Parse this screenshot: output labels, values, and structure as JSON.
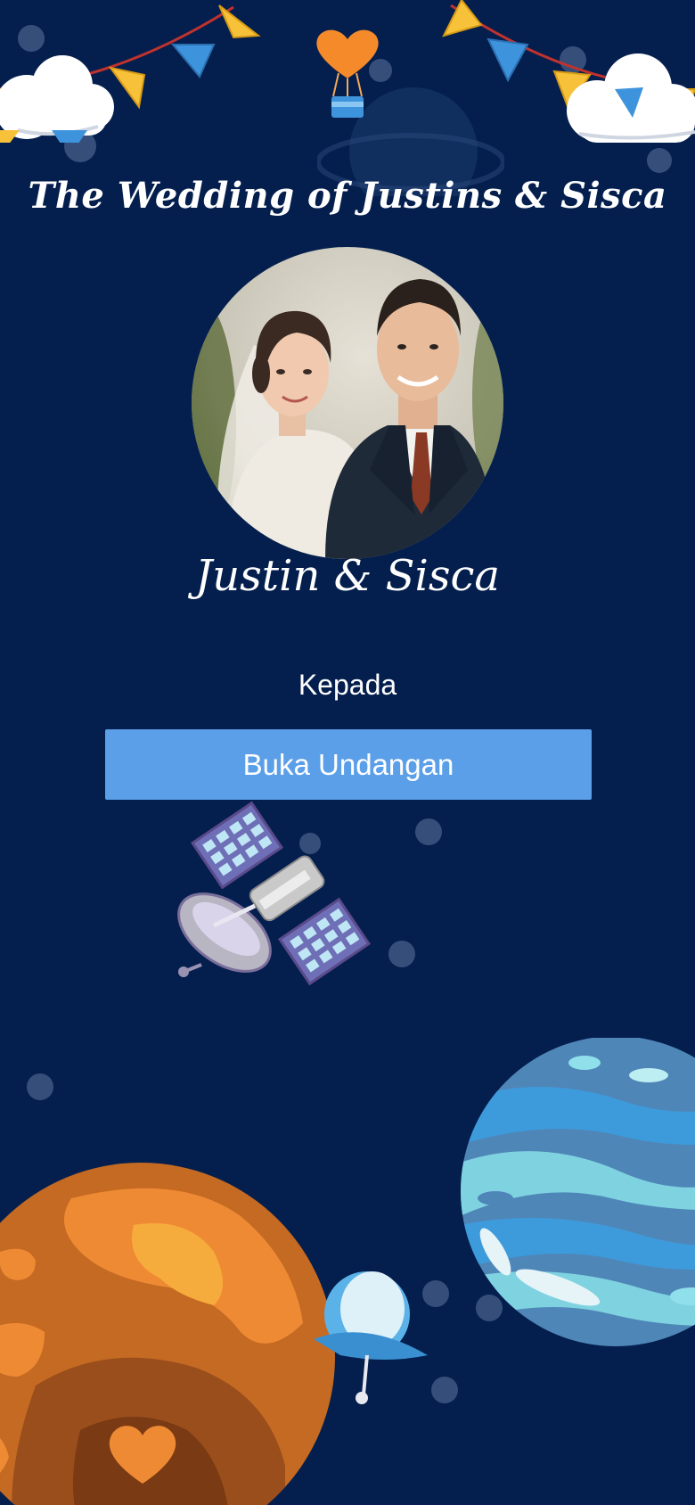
{
  "invitation": {
    "title": "The Wedding of Justins & Sisca",
    "couple_names": "Justin & Sisca",
    "recipient_label": "Kepada",
    "open_button_label": "Buka Undangan"
  },
  "colors": {
    "background": "#041f4e",
    "button": "#5b9fe8",
    "text": "#ffffff"
  },
  "icons": [
    "heart-balloon-icon",
    "bunting-flags-icon",
    "cloud-icon",
    "satellite-icon",
    "orange-planet-icon",
    "blue-planet-icon",
    "ufo-icon"
  ]
}
